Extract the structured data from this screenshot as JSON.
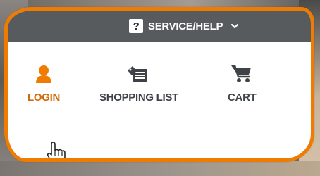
{
  "header": {
    "service_help": {
      "label": "SERVICE/HELP",
      "icon": "question-icon",
      "icon_glyph": "?",
      "dropdown_icon": "chevron-down-icon"
    }
  },
  "nav": {
    "items": [
      {
        "label": "LOGIN",
        "icon": "user-icon",
        "active": true
      },
      {
        "label": "SHOPPING LIST",
        "icon": "shopping-list-icon",
        "active": false
      },
      {
        "label": "CART",
        "icon": "cart-icon",
        "active": false
      }
    ]
  },
  "colors": {
    "accent": "#ef7c00",
    "active_text": "#d26a0c",
    "topbar": "#575b5e",
    "label_text": "#3f4347"
  }
}
